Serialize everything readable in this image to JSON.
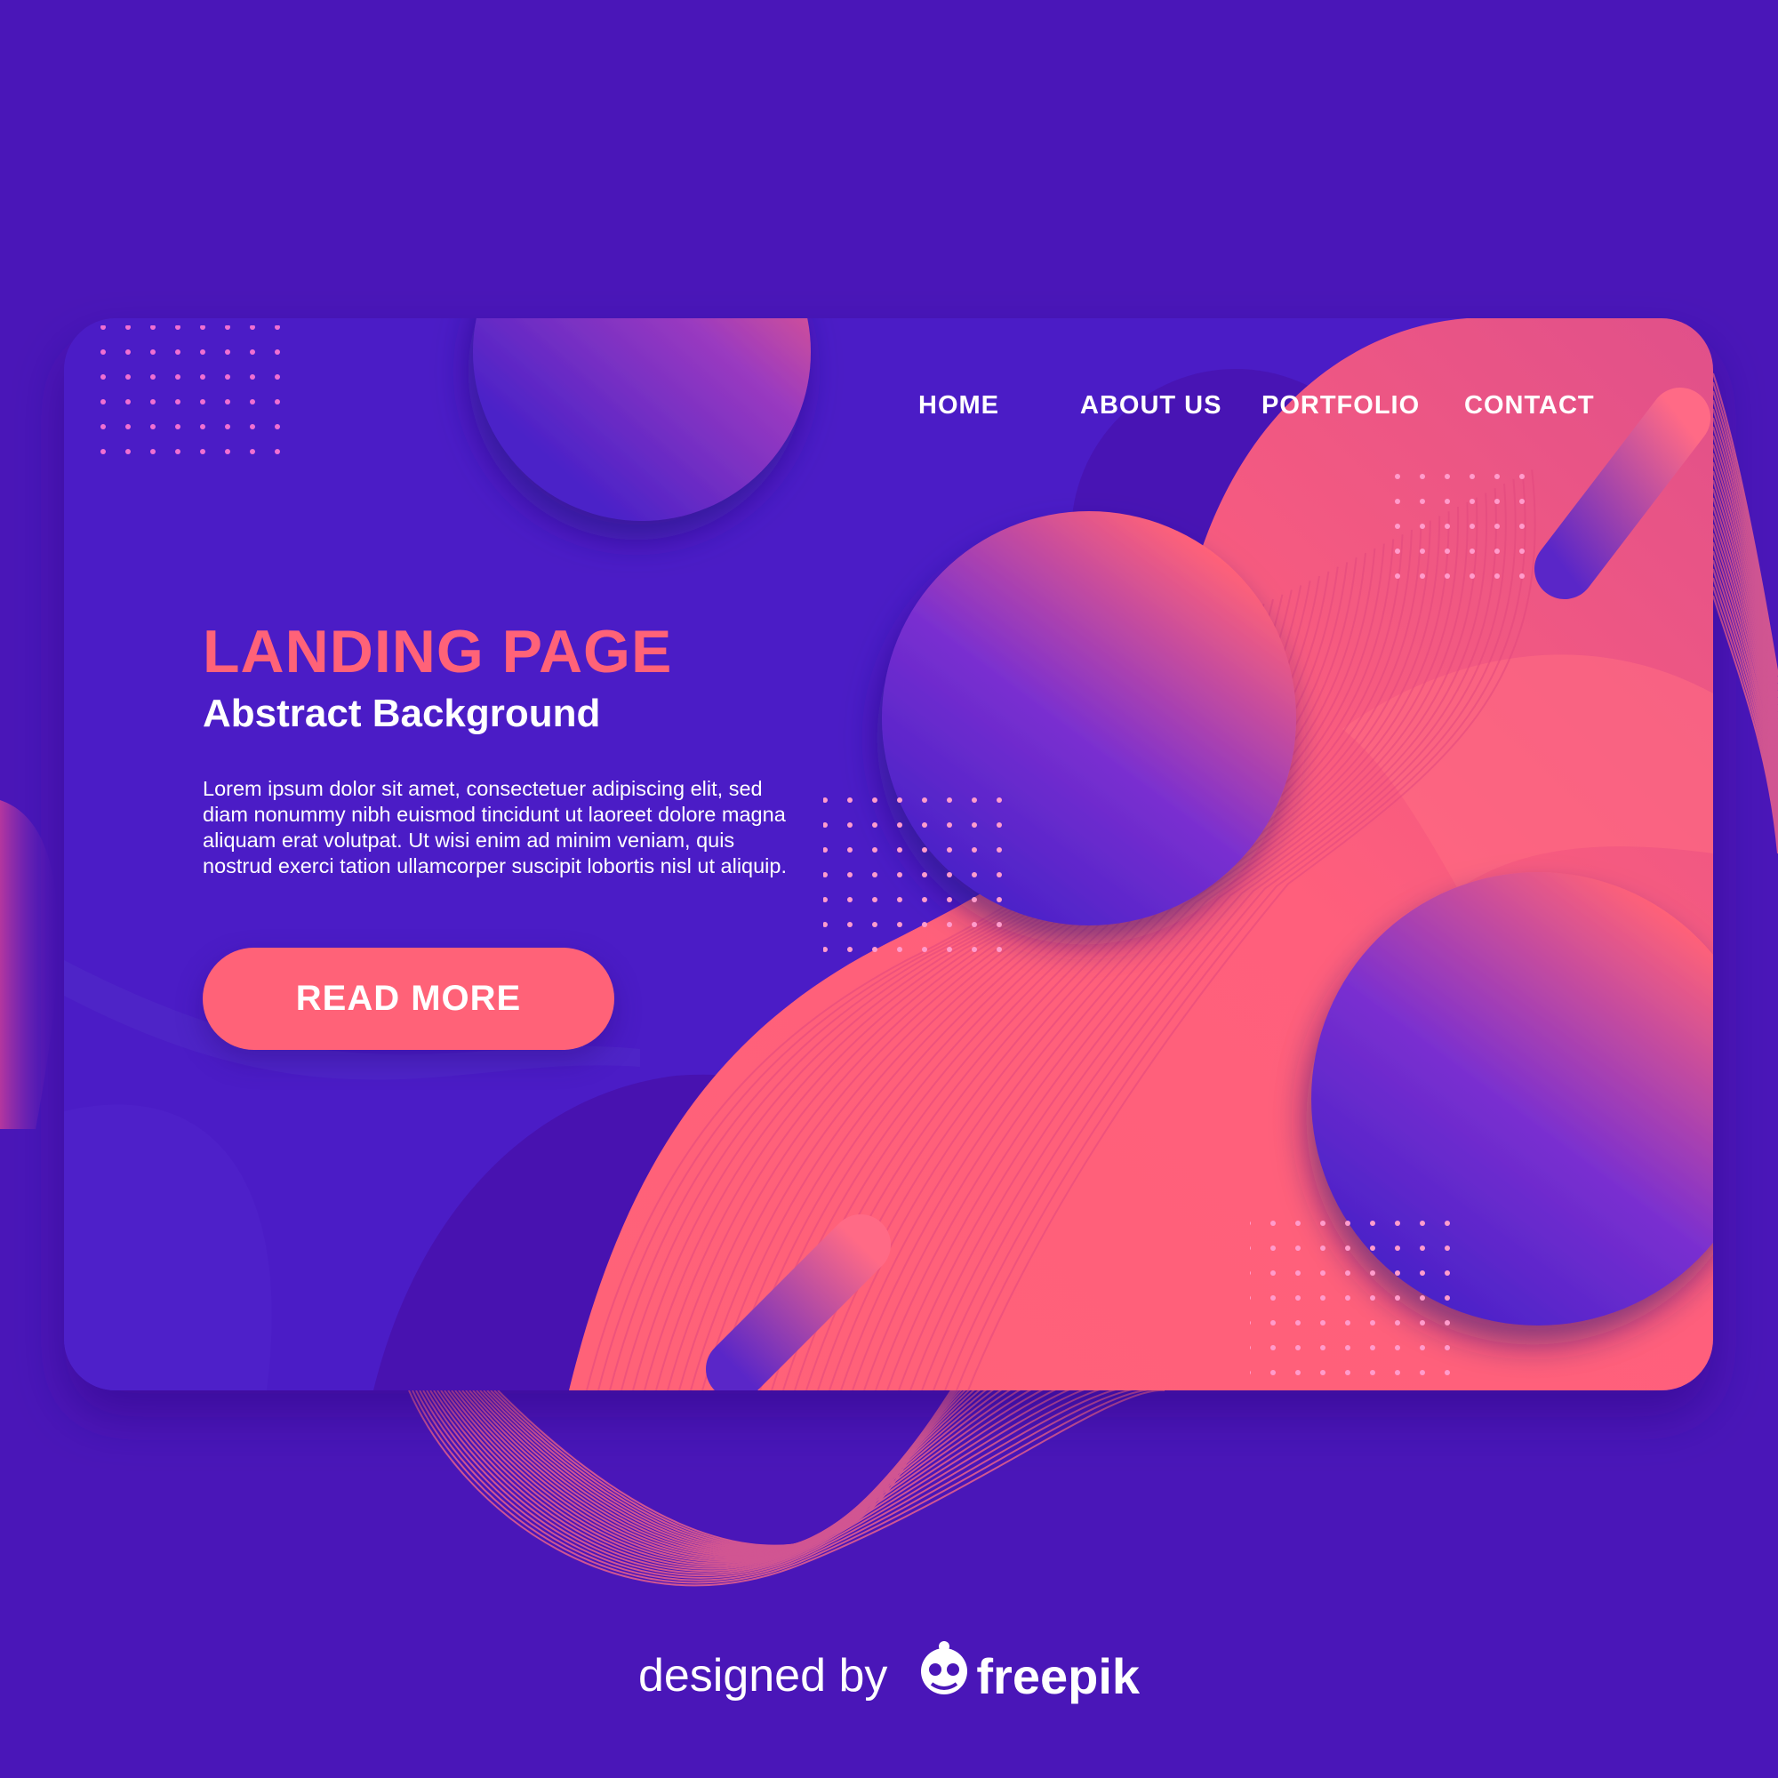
{
  "nav": {
    "home": "HOME",
    "about": "ABOUT US",
    "portfolio": "PORTFOLIO",
    "contact": "CONTACT"
  },
  "hero": {
    "title": "LANDING PAGE",
    "subtitle": "Abstract Background",
    "body": "Lorem ipsum dolor sit amet, consectetuer adipiscing elit, sed diam nonummy nibh euismod tincidunt ut laoreet dolore magna aliquam erat volutpat. Ut wisi enim ad minim veniam, quis nostrud exerci tation ullamcorper suscipit lobortis nisl ut aliquip.",
    "cta": "READ MORE"
  },
  "credit": {
    "prefix": "designed by",
    "brand": "freepik"
  },
  "colors": {
    "background": "#4a16b8",
    "card": "#4b1fc6",
    "accent": "#ff6278",
    "text": "#ffffff"
  },
  "icons": {
    "brand_logo": "freepik-logo-icon"
  }
}
